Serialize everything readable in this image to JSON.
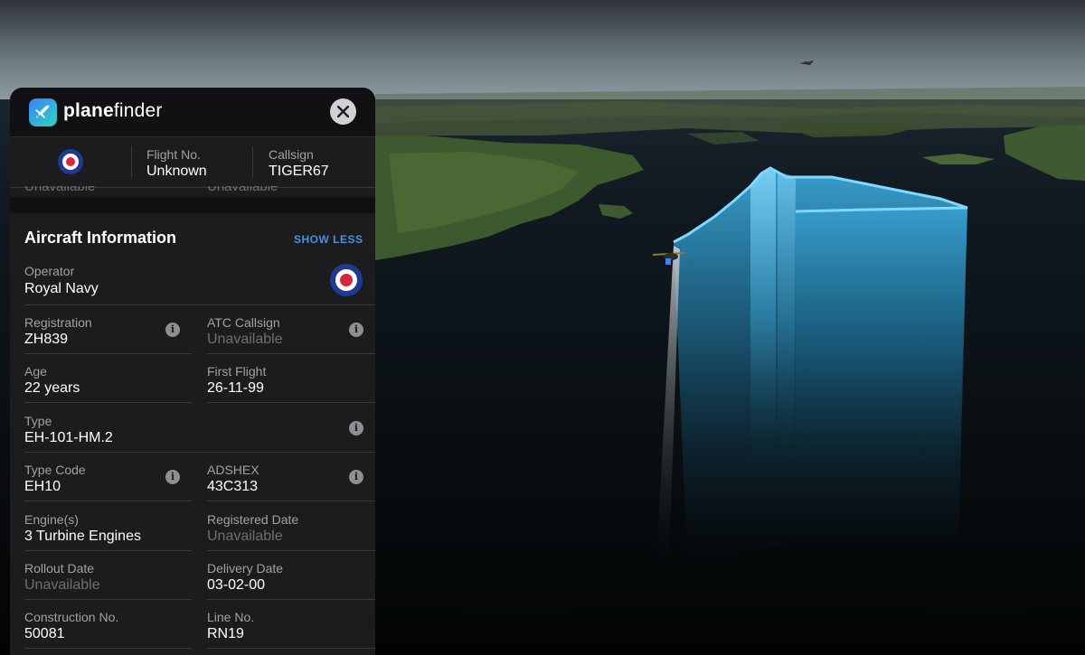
{
  "brand": {
    "name_bold": "plane",
    "name_light": "finder"
  },
  "flight_bar": {
    "flight_no_label": "Flight No.",
    "flight_no_value": "Unknown",
    "callsign_label": "Callsign",
    "callsign_value": "TIGER67"
  },
  "scrolled_hidden": {
    "left": "Unavailable",
    "right": "Unavailable"
  },
  "aircraft_info": {
    "title": "Aircraft Information",
    "show_less_label": "SHOW LESS",
    "operator_label": "Operator",
    "operator_value": "Royal Navy",
    "registration_label": "Registration",
    "registration_value": "ZH839",
    "atc_callsign_label": "ATC Callsign",
    "atc_callsign_value": "Unavailable",
    "age_label": "Age",
    "age_value": "22 years",
    "first_flight_label": "First Flight",
    "first_flight_value": "26-11-99",
    "type_label": "Type",
    "type_value": "EH-101-HM.2",
    "type_code_label": "Type Code",
    "type_code_value": "EH10",
    "adshex_label": "ADSHEX",
    "adshex_value": "43C313",
    "engines_label": "Engine(s)",
    "engines_value": "3 Turbine Engines",
    "registered_date_label": "Registered Date",
    "registered_date_value": "Unavailable",
    "rollout_date_label": "Rollout Date",
    "rollout_date_value": "Unavailable",
    "delivery_date_label": "Delivery Date",
    "delivery_date_value": "03-02-00",
    "construction_no_label": "Construction No.",
    "construction_no_value": "50081",
    "line_no_label": "Line No.",
    "line_no_value": "RN19"
  },
  "icons": {
    "close": "close-icon",
    "info": "info-icon",
    "roundel": "raf-roundel-icon",
    "logo": "planefinder-logo-icon"
  },
  "colors": {
    "accent": "#4a90e2",
    "track": "#5ac8fa",
    "panel_bg": "#1c1c1e",
    "roundel_blue": "#1f3a93",
    "roundel_red": "#d7263d"
  }
}
